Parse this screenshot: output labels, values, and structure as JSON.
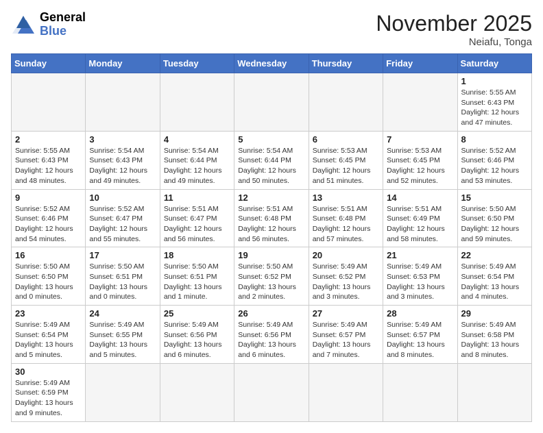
{
  "header": {
    "logo_general": "General",
    "logo_blue": "Blue",
    "month_title": "November 2025",
    "location": "Neiafu, Tonga"
  },
  "weekdays": [
    "Sunday",
    "Monday",
    "Tuesday",
    "Wednesday",
    "Thursday",
    "Friday",
    "Saturday"
  ],
  "weeks": [
    [
      {
        "day": "",
        "info": ""
      },
      {
        "day": "",
        "info": ""
      },
      {
        "day": "",
        "info": ""
      },
      {
        "day": "",
        "info": ""
      },
      {
        "day": "",
        "info": ""
      },
      {
        "day": "",
        "info": ""
      },
      {
        "day": "1",
        "info": "Sunrise: 5:55 AM\nSunset: 6:43 PM\nDaylight: 12 hours\nand 47 minutes."
      }
    ],
    [
      {
        "day": "2",
        "info": "Sunrise: 5:55 AM\nSunset: 6:43 PM\nDaylight: 12 hours\nand 48 minutes."
      },
      {
        "day": "3",
        "info": "Sunrise: 5:54 AM\nSunset: 6:43 PM\nDaylight: 12 hours\nand 49 minutes."
      },
      {
        "day": "4",
        "info": "Sunrise: 5:54 AM\nSunset: 6:44 PM\nDaylight: 12 hours\nand 49 minutes."
      },
      {
        "day": "5",
        "info": "Sunrise: 5:54 AM\nSunset: 6:44 PM\nDaylight: 12 hours\nand 50 minutes."
      },
      {
        "day": "6",
        "info": "Sunrise: 5:53 AM\nSunset: 6:45 PM\nDaylight: 12 hours\nand 51 minutes."
      },
      {
        "day": "7",
        "info": "Sunrise: 5:53 AM\nSunset: 6:45 PM\nDaylight: 12 hours\nand 52 minutes."
      },
      {
        "day": "8",
        "info": "Sunrise: 5:52 AM\nSunset: 6:46 PM\nDaylight: 12 hours\nand 53 minutes."
      }
    ],
    [
      {
        "day": "9",
        "info": "Sunrise: 5:52 AM\nSunset: 6:46 PM\nDaylight: 12 hours\nand 54 minutes."
      },
      {
        "day": "10",
        "info": "Sunrise: 5:52 AM\nSunset: 6:47 PM\nDaylight: 12 hours\nand 55 minutes."
      },
      {
        "day": "11",
        "info": "Sunrise: 5:51 AM\nSunset: 6:47 PM\nDaylight: 12 hours\nand 56 minutes."
      },
      {
        "day": "12",
        "info": "Sunrise: 5:51 AM\nSunset: 6:48 PM\nDaylight: 12 hours\nand 56 minutes."
      },
      {
        "day": "13",
        "info": "Sunrise: 5:51 AM\nSunset: 6:48 PM\nDaylight: 12 hours\nand 57 minutes."
      },
      {
        "day": "14",
        "info": "Sunrise: 5:51 AM\nSunset: 6:49 PM\nDaylight: 12 hours\nand 58 minutes."
      },
      {
        "day": "15",
        "info": "Sunrise: 5:50 AM\nSunset: 6:50 PM\nDaylight: 12 hours\nand 59 minutes."
      }
    ],
    [
      {
        "day": "16",
        "info": "Sunrise: 5:50 AM\nSunset: 6:50 PM\nDaylight: 13 hours\nand 0 minutes."
      },
      {
        "day": "17",
        "info": "Sunrise: 5:50 AM\nSunset: 6:51 PM\nDaylight: 13 hours\nand 0 minutes."
      },
      {
        "day": "18",
        "info": "Sunrise: 5:50 AM\nSunset: 6:51 PM\nDaylight: 13 hours\nand 1 minute."
      },
      {
        "day": "19",
        "info": "Sunrise: 5:50 AM\nSunset: 6:52 PM\nDaylight: 13 hours\nand 2 minutes."
      },
      {
        "day": "20",
        "info": "Sunrise: 5:49 AM\nSunset: 6:52 PM\nDaylight: 13 hours\nand 3 minutes."
      },
      {
        "day": "21",
        "info": "Sunrise: 5:49 AM\nSunset: 6:53 PM\nDaylight: 13 hours\nand 3 minutes."
      },
      {
        "day": "22",
        "info": "Sunrise: 5:49 AM\nSunset: 6:54 PM\nDaylight: 13 hours\nand 4 minutes."
      }
    ],
    [
      {
        "day": "23",
        "info": "Sunrise: 5:49 AM\nSunset: 6:54 PM\nDaylight: 13 hours\nand 5 minutes."
      },
      {
        "day": "24",
        "info": "Sunrise: 5:49 AM\nSunset: 6:55 PM\nDaylight: 13 hours\nand 5 minutes."
      },
      {
        "day": "25",
        "info": "Sunrise: 5:49 AM\nSunset: 6:56 PM\nDaylight: 13 hours\nand 6 minutes."
      },
      {
        "day": "26",
        "info": "Sunrise: 5:49 AM\nSunset: 6:56 PM\nDaylight: 13 hours\nand 6 minutes."
      },
      {
        "day": "27",
        "info": "Sunrise: 5:49 AM\nSunset: 6:57 PM\nDaylight: 13 hours\nand 7 minutes."
      },
      {
        "day": "28",
        "info": "Sunrise: 5:49 AM\nSunset: 6:57 PM\nDaylight: 13 hours\nand 8 minutes."
      },
      {
        "day": "29",
        "info": "Sunrise: 5:49 AM\nSunset: 6:58 PM\nDaylight: 13 hours\nand 8 minutes."
      }
    ],
    [
      {
        "day": "30",
        "info": "Sunrise: 5:49 AM\nSunset: 6:59 PM\nDaylight: 13 hours\nand 9 minutes."
      },
      {
        "day": "",
        "info": ""
      },
      {
        "day": "",
        "info": ""
      },
      {
        "day": "",
        "info": ""
      },
      {
        "day": "",
        "info": ""
      },
      {
        "day": "",
        "info": ""
      },
      {
        "day": "",
        "info": ""
      }
    ]
  ]
}
